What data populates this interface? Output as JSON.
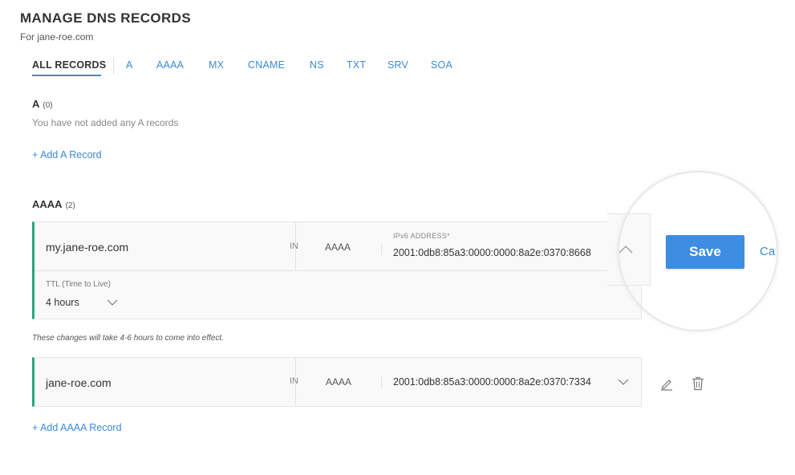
{
  "page": {
    "title": "MANAGE DNS RECORDS",
    "subtitle": "For jane-roe.com"
  },
  "tabs": [
    {
      "label": "ALL RECORDS",
      "active": true
    },
    {
      "label": "A"
    },
    {
      "label": "AAAA"
    },
    {
      "label": "MX"
    },
    {
      "label": "CNAME"
    },
    {
      "label": "NS"
    },
    {
      "label": "TXT"
    },
    {
      "label": "SRV"
    },
    {
      "label": "SOA"
    }
  ],
  "section_a": {
    "heading": "A",
    "count": "(0)",
    "empty_text": "You have not added any A records",
    "add_link": "+ Add A Record"
  },
  "section_aaaa": {
    "heading": "AAAA",
    "count": "(2)",
    "add_link": "+ Add AAAA Record",
    "records": [
      {
        "host": "my.jane-roe.com",
        "class": "IN",
        "type": "AAAA",
        "field_label": "IPv6 ADDRESS*",
        "value": "2001:0db8:85a3:0000:0000:8a2e:0370:8668",
        "ttl_label": "TTL (Time to Live)",
        "ttl_value": "4 hours",
        "expanded": true
      },
      {
        "host": "jane-roe.com",
        "class": "IN",
        "type": "AAAA",
        "value": "2001:0db8:85a3:0000:0000:8a2e:0370:7334",
        "expanded": false
      }
    ],
    "note": "These changes will take 4-6 hours to come into effect."
  },
  "actions": {
    "save_label": "Save",
    "cancel_label": "Ca"
  },
  "colors": {
    "accent": "#3b8ad8",
    "save_button": "#3d8de3",
    "record_bar": "#2aa57b"
  },
  "icons": [
    "chevron-up-icon",
    "chevron-down-icon",
    "pencil-icon",
    "trash-icon"
  ]
}
